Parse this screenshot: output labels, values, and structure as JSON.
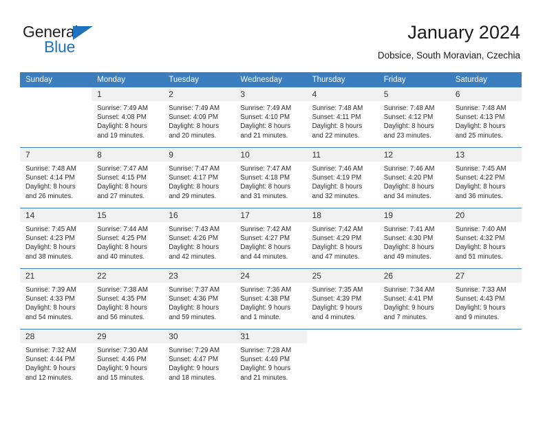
{
  "logo": {
    "name_part1": "General",
    "name_part2": "Blue",
    "triangle_color": "#1f72bd"
  },
  "header": {
    "title": "January 2024",
    "subtitle": "Dobsice, South Moravian, Czechia"
  },
  "theme": {
    "header_blue": "#3a7ebf",
    "daynum_bg": "#f1f1f1",
    "text": "#2b2b2b"
  },
  "weekday_headers": [
    "Sunday",
    "Monday",
    "Tuesday",
    "Wednesday",
    "Thursday",
    "Friday",
    "Saturday"
  ],
  "weeks": [
    [
      {
        "day": "",
        "sunrise": "",
        "sunset": "",
        "daylight1": "",
        "daylight2": ""
      },
      {
        "day": "1",
        "sunrise": "Sunrise: 7:49 AM",
        "sunset": "Sunset: 4:08 PM",
        "daylight1": "Daylight: 8 hours",
        "daylight2": "and 19 minutes."
      },
      {
        "day": "2",
        "sunrise": "Sunrise: 7:49 AM",
        "sunset": "Sunset: 4:09 PM",
        "daylight1": "Daylight: 8 hours",
        "daylight2": "and 20 minutes."
      },
      {
        "day": "3",
        "sunrise": "Sunrise: 7:49 AM",
        "sunset": "Sunset: 4:10 PM",
        "daylight1": "Daylight: 8 hours",
        "daylight2": "and 21 minutes."
      },
      {
        "day": "4",
        "sunrise": "Sunrise: 7:48 AM",
        "sunset": "Sunset: 4:11 PM",
        "daylight1": "Daylight: 8 hours",
        "daylight2": "and 22 minutes."
      },
      {
        "day": "5",
        "sunrise": "Sunrise: 7:48 AM",
        "sunset": "Sunset: 4:12 PM",
        "daylight1": "Daylight: 8 hours",
        "daylight2": "and 23 minutes."
      },
      {
        "day": "6",
        "sunrise": "Sunrise: 7:48 AM",
        "sunset": "Sunset: 4:13 PM",
        "daylight1": "Daylight: 8 hours",
        "daylight2": "and 25 minutes."
      }
    ],
    [
      {
        "day": "7",
        "sunrise": "Sunrise: 7:48 AM",
        "sunset": "Sunset: 4:14 PM",
        "daylight1": "Daylight: 8 hours",
        "daylight2": "and 26 minutes."
      },
      {
        "day": "8",
        "sunrise": "Sunrise: 7:47 AM",
        "sunset": "Sunset: 4:15 PM",
        "daylight1": "Daylight: 8 hours",
        "daylight2": "and 27 minutes."
      },
      {
        "day": "9",
        "sunrise": "Sunrise: 7:47 AM",
        "sunset": "Sunset: 4:17 PM",
        "daylight1": "Daylight: 8 hours",
        "daylight2": "and 29 minutes."
      },
      {
        "day": "10",
        "sunrise": "Sunrise: 7:47 AM",
        "sunset": "Sunset: 4:18 PM",
        "daylight1": "Daylight: 8 hours",
        "daylight2": "and 31 minutes."
      },
      {
        "day": "11",
        "sunrise": "Sunrise: 7:46 AM",
        "sunset": "Sunset: 4:19 PM",
        "daylight1": "Daylight: 8 hours",
        "daylight2": "and 32 minutes."
      },
      {
        "day": "12",
        "sunrise": "Sunrise: 7:46 AM",
        "sunset": "Sunset: 4:20 PM",
        "daylight1": "Daylight: 8 hours",
        "daylight2": "and 34 minutes."
      },
      {
        "day": "13",
        "sunrise": "Sunrise: 7:45 AM",
        "sunset": "Sunset: 4:22 PM",
        "daylight1": "Daylight: 8 hours",
        "daylight2": "and 36 minutes."
      }
    ],
    [
      {
        "day": "14",
        "sunrise": "Sunrise: 7:45 AM",
        "sunset": "Sunset: 4:23 PM",
        "daylight1": "Daylight: 8 hours",
        "daylight2": "and 38 minutes."
      },
      {
        "day": "15",
        "sunrise": "Sunrise: 7:44 AM",
        "sunset": "Sunset: 4:25 PM",
        "daylight1": "Daylight: 8 hours",
        "daylight2": "and 40 minutes."
      },
      {
        "day": "16",
        "sunrise": "Sunrise: 7:43 AM",
        "sunset": "Sunset: 4:26 PM",
        "daylight1": "Daylight: 8 hours",
        "daylight2": "and 42 minutes."
      },
      {
        "day": "17",
        "sunrise": "Sunrise: 7:42 AM",
        "sunset": "Sunset: 4:27 PM",
        "daylight1": "Daylight: 8 hours",
        "daylight2": "and 44 minutes."
      },
      {
        "day": "18",
        "sunrise": "Sunrise: 7:42 AM",
        "sunset": "Sunset: 4:29 PM",
        "daylight1": "Daylight: 8 hours",
        "daylight2": "and 47 minutes."
      },
      {
        "day": "19",
        "sunrise": "Sunrise: 7:41 AM",
        "sunset": "Sunset: 4:30 PM",
        "daylight1": "Daylight: 8 hours",
        "daylight2": "and 49 minutes."
      },
      {
        "day": "20",
        "sunrise": "Sunrise: 7:40 AM",
        "sunset": "Sunset: 4:32 PM",
        "daylight1": "Daylight: 8 hours",
        "daylight2": "and 51 minutes."
      }
    ],
    [
      {
        "day": "21",
        "sunrise": "Sunrise: 7:39 AM",
        "sunset": "Sunset: 4:33 PM",
        "daylight1": "Daylight: 8 hours",
        "daylight2": "and 54 minutes."
      },
      {
        "day": "22",
        "sunrise": "Sunrise: 7:38 AM",
        "sunset": "Sunset: 4:35 PM",
        "daylight1": "Daylight: 8 hours",
        "daylight2": "and 56 minutes."
      },
      {
        "day": "23",
        "sunrise": "Sunrise: 7:37 AM",
        "sunset": "Sunset: 4:36 PM",
        "daylight1": "Daylight: 8 hours",
        "daylight2": "and 59 minutes."
      },
      {
        "day": "24",
        "sunrise": "Sunrise: 7:36 AM",
        "sunset": "Sunset: 4:38 PM",
        "daylight1": "Daylight: 9 hours",
        "daylight2": "and 1 minute."
      },
      {
        "day": "25",
        "sunrise": "Sunrise: 7:35 AM",
        "sunset": "Sunset: 4:39 PM",
        "daylight1": "Daylight: 9 hours",
        "daylight2": "and 4 minutes."
      },
      {
        "day": "26",
        "sunrise": "Sunrise: 7:34 AM",
        "sunset": "Sunset: 4:41 PM",
        "daylight1": "Daylight: 9 hours",
        "daylight2": "and 7 minutes."
      },
      {
        "day": "27",
        "sunrise": "Sunrise: 7:33 AM",
        "sunset": "Sunset: 4:43 PM",
        "daylight1": "Daylight: 9 hours",
        "daylight2": "and 9 minutes."
      }
    ],
    [
      {
        "day": "28",
        "sunrise": "Sunrise: 7:32 AM",
        "sunset": "Sunset: 4:44 PM",
        "daylight1": "Daylight: 9 hours",
        "daylight2": "and 12 minutes."
      },
      {
        "day": "29",
        "sunrise": "Sunrise: 7:30 AM",
        "sunset": "Sunset: 4:46 PM",
        "daylight1": "Daylight: 9 hours",
        "daylight2": "and 15 minutes."
      },
      {
        "day": "30",
        "sunrise": "Sunrise: 7:29 AM",
        "sunset": "Sunset: 4:47 PM",
        "daylight1": "Daylight: 9 hours",
        "daylight2": "and 18 minutes."
      },
      {
        "day": "31",
        "sunrise": "Sunrise: 7:28 AM",
        "sunset": "Sunset: 4:49 PM",
        "daylight1": "Daylight: 9 hours",
        "daylight2": "and 21 minutes."
      },
      {
        "day": "",
        "sunrise": "",
        "sunset": "",
        "daylight1": "",
        "daylight2": ""
      },
      {
        "day": "",
        "sunrise": "",
        "sunset": "",
        "daylight1": "",
        "daylight2": ""
      },
      {
        "day": "",
        "sunrise": "",
        "sunset": "",
        "daylight1": "",
        "daylight2": ""
      }
    ]
  ]
}
